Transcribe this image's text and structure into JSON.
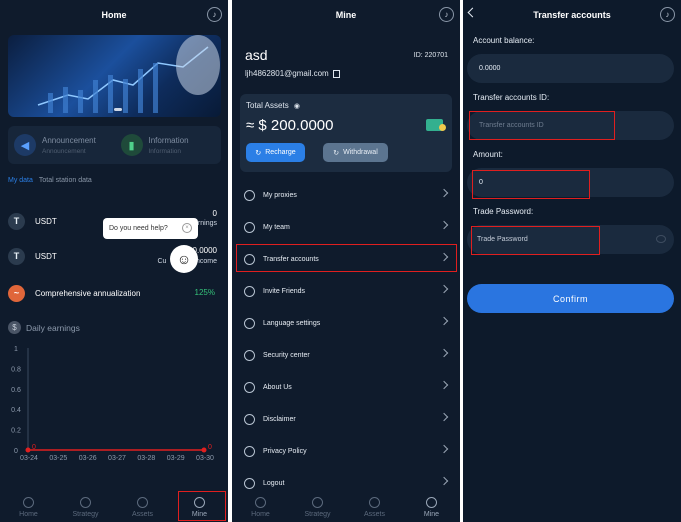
{
  "home": {
    "title": "Home",
    "features": [
      {
        "title": "Announcement",
        "subtitle": "Announcement"
      },
      {
        "title": "Information",
        "subtitle": "Information"
      }
    ],
    "tabs": [
      "My data",
      "Total station data"
    ],
    "rows": [
      {
        "label": "USDT",
        "value": "0",
        "sub": "earnings"
      },
      {
        "label": "USDT",
        "value": "0.0000",
        "sub_left": "Cu",
        "sub": "income"
      },
      {
        "label": "Comprehensive annualization",
        "value": "125%"
      }
    ],
    "help_text": "Do you need help?",
    "chart_title": "Daily earnings",
    "colors": {
      "accent": "#2b7fe6",
      "green": "#35c27a",
      "red": "#e01f1f"
    }
  },
  "chart_data": {
    "type": "line",
    "title": "Daily earnings",
    "categories": [
      "03-24",
      "03-25",
      "03-26",
      "03-27",
      "03-28",
      "03-29",
      "03-30"
    ],
    "y_ticks": [
      "1",
      "0.8",
      "0.6",
      "0.4",
      "0.2",
      "0"
    ],
    "ylim": [
      0,
      1
    ],
    "series": [
      {
        "values": [
          0,
          0,
          0,
          0,
          0,
          0,
          0
        ]
      }
    ],
    "endpoint_labels": [
      "0",
      "0"
    ]
  },
  "mine": {
    "title": "Mine",
    "username": "asd",
    "id_text": "ID: 220701",
    "email": "ljh4862801@gmail.com",
    "total_assets_label": "Total Assets",
    "total_assets_value": "≈ $ 200.0000",
    "recharge_label": "Recharge",
    "withdraw_label": "Withdrawal",
    "menu": [
      "My proxies",
      "My team",
      "Transfer accounts",
      "Invite Friends",
      "Language settings",
      "Security center",
      "About Us",
      "Disclaimer",
      "Privacy Policy",
      "Logout"
    ]
  },
  "nav": [
    "Home",
    "Strategy",
    "Assets",
    "Mine"
  ],
  "transfer": {
    "title": "Transfer accounts",
    "balance_label": "Account balance:",
    "balance_value": "0.0000",
    "id_label": "Transfer accounts ID:",
    "id_placeholder": "Transfer accounts ID",
    "amount_label": "Amount:",
    "amount_value": "0",
    "password_label": "Trade Password:",
    "password_placeholder": "Trade Password",
    "confirm_label": "Confirm"
  }
}
